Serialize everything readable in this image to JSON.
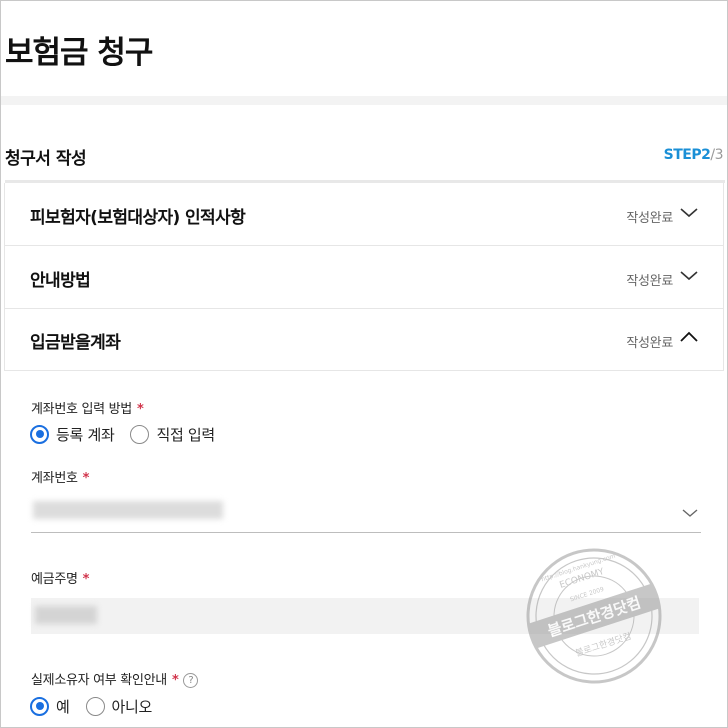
{
  "page": {
    "title": "보험금 청구"
  },
  "section": {
    "title": "청구서 작성",
    "step_label": "STEP",
    "step_current": "2",
    "step_sep": "/",
    "step_total": "3"
  },
  "accordion": [
    {
      "title": "피보험자(보험대상자) 인적사항",
      "status": "작성완료",
      "expanded": false
    },
    {
      "title": "안내방법",
      "status": "작성완료",
      "expanded": false
    },
    {
      "title": "입금받을계좌",
      "status": "작성완료",
      "expanded": true
    }
  ],
  "account_form": {
    "input_method": {
      "label": "계좌번호 입력 방법",
      "required": "*",
      "options": [
        "등록 계좌",
        "직접 입력"
      ],
      "selected": 0
    },
    "account_number": {
      "label": "계좌번호",
      "required": "*"
    },
    "holder": {
      "label": "예금주명",
      "required": "*"
    },
    "owner_check": {
      "label": "실제소유자 여부 확인안내",
      "required": "*",
      "help": "?",
      "options": [
        "예",
        "아니오"
      ],
      "selected": 0
    }
  },
  "watermark": {
    "text": "블로그한경닷컴",
    "top_text": "ECONOMY",
    "ring_text": "http://blog.hankyung.com",
    "sub_text": "SINCE 2009",
    "bottom_text": "블로그한경닷컴",
    "icon": "seal-stamp"
  },
  "colors": {
    "accent": "#1a6fe0",
    "step": "#1a8fd6",
    "required": "#d1344b"
  },
  "icons": {
    "collapsed": "chevron-down-icon",
    "expanded": "chevron-up-icon",
    "help": "question-circle-icon",
    "select": "chevron-down-icon"
  }
}
